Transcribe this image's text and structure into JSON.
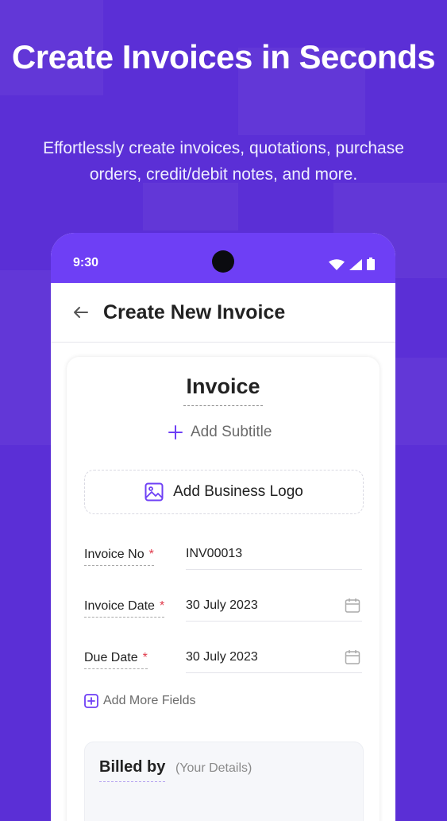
{
  "hero": {
    "title": "Create Invoices in Seconds",
    "subtitle": "Effortlessly create invoices, quotations, purchase orders, credit/debit notes, and more."
  },
  "status_bar": {
    "time": "9:30"
  },
  "app_bar": {
    "title": "Create New Invoice"
  },
  "invoice": {
    "title": "Invoice",
    "add_subtitle": "Add Subtitle",
    "add_logo": "Add Business Logo",
    "fields": [
      {
        "label": "Invoice No",
        "value": "INV00013"
      },
      {
        "label": "Invoice Date",
        "value": "30 July 2023"
      },
      {
        "label": "Due Date",
        "value": "30 July 2023"
      }
    ],
    "required_mark": "*",
    "add_more_fields": "Add More Fields",
    "billed_by": {
      "title": "Billed by",
      "subtitle": "(Your Details)"
    }
  },
  "colors": {
    "background": "#5b2fd6",
    "accent": "#6e3ff5",
    "required": "#e0394a"
  }
}
